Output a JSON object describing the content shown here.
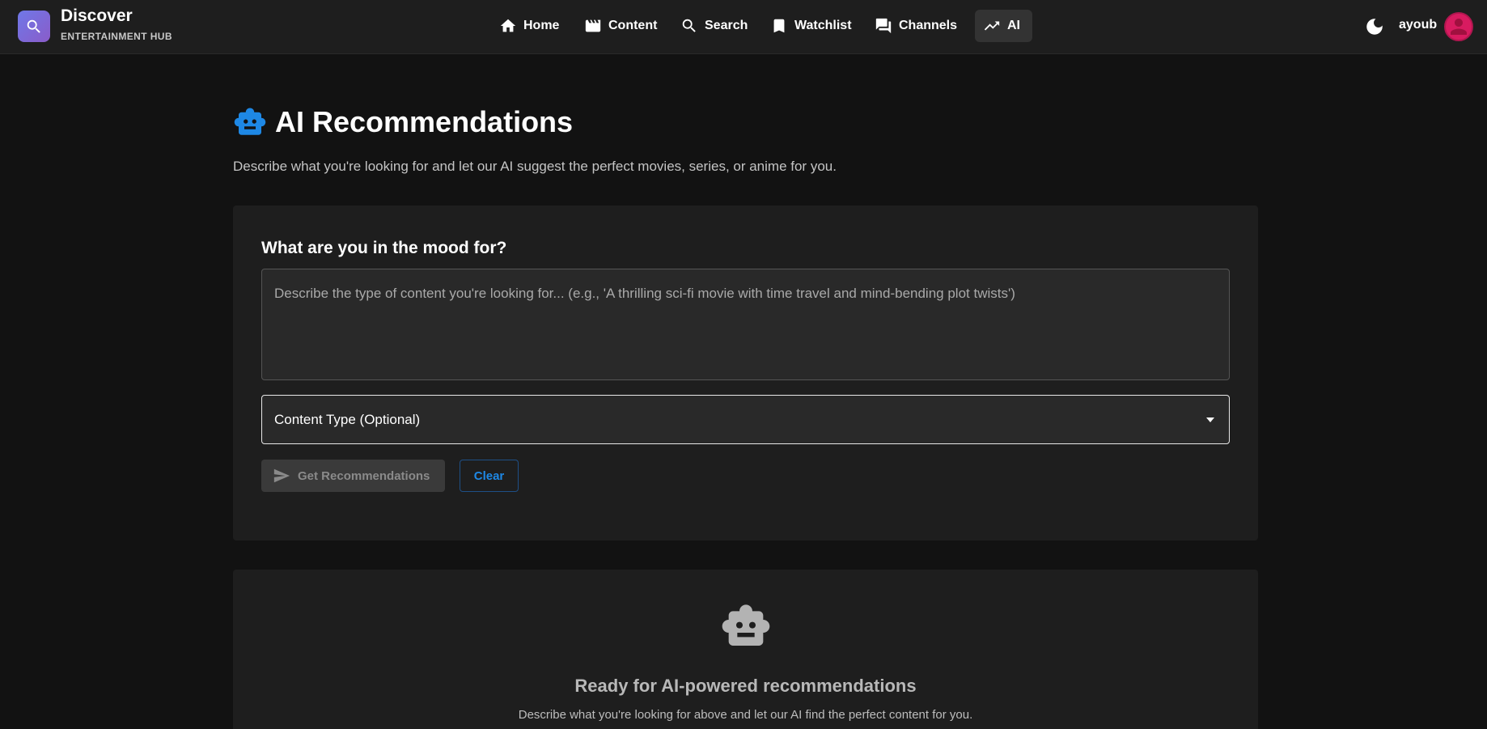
{
  "app": {
    "name": "Discover",
    "subtitle": "ENTERTAINMENT HUB",
    "logo_icon": "search-icon",
    "accent_color": "#1e88e5"
  },
  "nav": {
    "items": [
      {
        "label": "Home",
        "icon": "home-icon",
        "active": false
      },
      {
        "label": "Content",
        "icon": "movie-icon",
        "active": false
      },
      {
        "label": "Search",
        "icon": "search-icon",
        "active": false
      },
      {
        "label": "Watchlist",
        "icon": "bookmark-icon",
        "active": false
      },
      {
        "label": "Channels",
        "icon": "chat-icon",
        "active": false
      },
      {
        "label": "AI",
        "icon": "trending-up-icon",
        "active": true
      }
    ]
  },
  "user": {
    "name": "ayoub",
    "theme_icon": "moon-icon",
    "avatar_color": "#d81b60"
  },
  "page": {
    "title": "AI Recommendations",
    "title_icon": "robot-icon",
    "description": "Describe what you're looking for and let our AI suggest the perfect movies, series, or anime for you."
  },
  "form": {
    "heading": "What are you in the mood for?",
    "textarea": {
      "value": "",
      "placeholder": "Describe the type of content you're looking for... (e.g., 'A thrilling sci-fi movie with time travel and mind-bending plot twists')"
    },
    "content_type": {
      "label": "Content Type (Optional)",
      "selected": ""
    },
    "submit_label": "Get Recommendations",
    "submit_disabled": true,
    "clear_label": "Clear"
  },
  "empty_state": {
    "icon": "robot-icon",
    "title": "Ready for AI-powered recommendations",
    "description": "Describe what you're looking for above and let our AI find the perfect content for you."
  }
}
